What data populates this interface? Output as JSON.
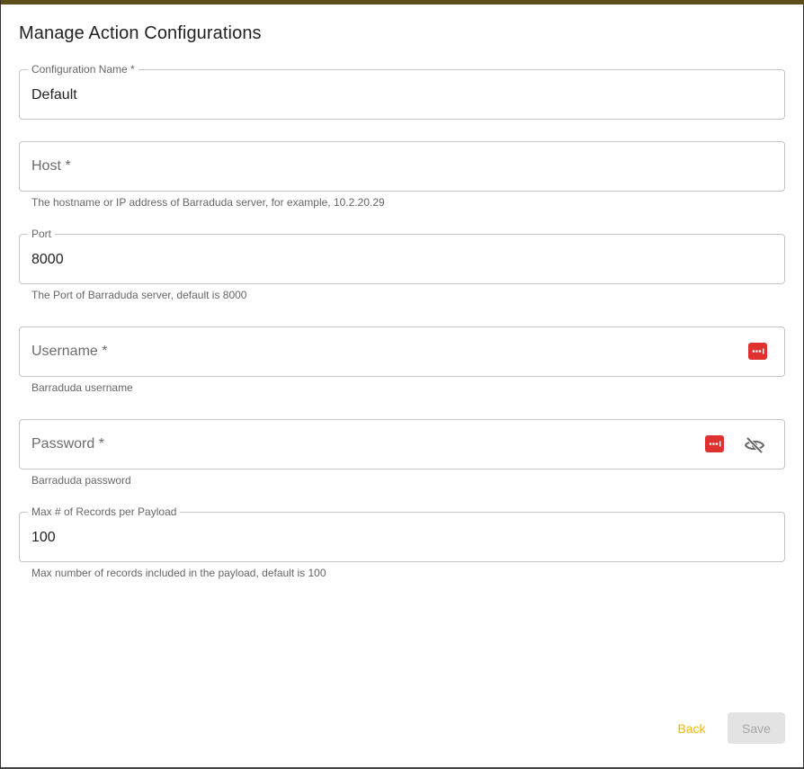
{
  "dialog": {
    "title": "Manage Action Configurations"
  },
  "fields": {
    "config_name": {
      "label": "Configuration Name *",
      "value": "Default"
    },
    "host": {
      "placeholder": "Host *",
      "helper": "The hostname or IP address of Barraduda server, for example, 10.2.20.29"
    },
    "port": {
      "label": "Port",
      "value": "8000",
      "helper": "The Port of Barraduda server, default is 8000"
    },
    "username": {
      "placeholder": "Username *",
      "helper": "Barraduda username",
      "icon": "password-manager-icon"
    },
    "password": {
      "placeholder": "Password *",
      "helper": "Barraduda password",
      "icon": "password-manager-icon",
      "toggle_icon": "eye-off-icon"
    },
    "max_records": {
      "label": "Max # of Records per Payload",
      "value": "100",
      "helper": "Max number of records included in the payload, default is 100"
    }
  },
  "actions": {
    "back_label": "Back",
    "save_label": "Save"
  },
  "colors": {
    "accent": "#f2b70a",
    "top_bar": "#5c4f1c",
    "password_badge": "#e03131"
  }
}
